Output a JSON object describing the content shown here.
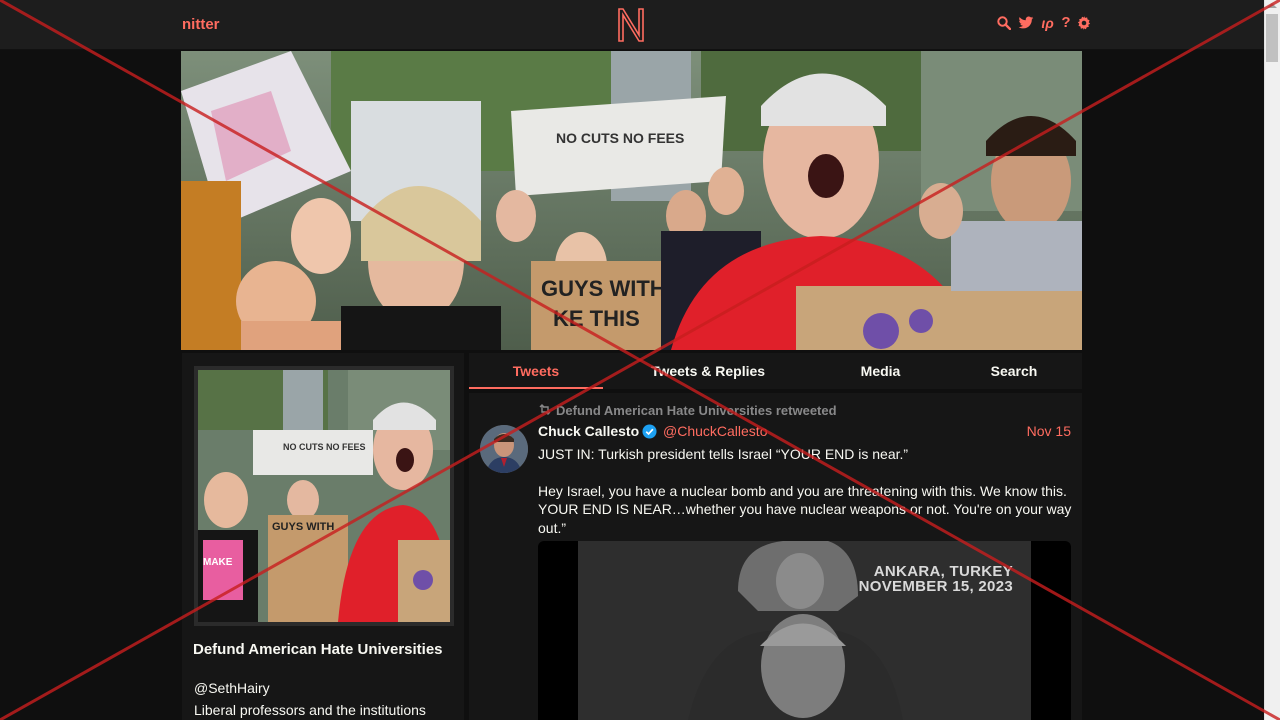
{
  "nav": {
    "brand": "nitter",
    "logo_letter": "N",
    "icons": [
      "search-icon",
      "twitter-bird-icon",
      "rss-icon",
      "help-icon",
      "gear-icon"
    ],
    "help_glyph": "?",
    "rss_glyph": "ιρ"
  },
  "profile": {
    "fullname": "Defund American Hate Universities",
    "username": "@SethHairy",
    "bio": "Liberal professors and the institutions"
  },
  "tabs": [
    {
      "label": "Tweets",
      "active": true
    },
    {
      "label": "Tweets & Replies",
      "active": false
    },
    {
      "label": "Media",
      "active": false
    },
    {
      "label": "Search",
      "active": false
    }
  ],
  "tweet": {
    "retweet_header": "Defund American Hate Universities retweeted",
    "author_name": "Chuck Callesto",
    "author_handle": "@ChuckCallesto",
    "date": "Nov 15",
    "paragraphs": [
      "JUST IN: Turkish president tells Israel “YOUR END is near.”",
      "Hey Israel, you have a nuclear bomb and you are threatening with this. We know this. YOUR END IS NEAR…whether you have nuclear weapons or not. You're on your way out.”"
    ],
    "media_location": "ANKARA, TURKEY",
    "media_date": "NOVEMBER 15, 2023"
  },
  "colors": {
    "accent": "#ff6c60",
    "background": "#0f0f0f",
    "panel": "#161616",
    "navbar": "#1d1d1d",
    "muted": "#888889",
    "overlay_cross": "#c81e1e"
  }
}
